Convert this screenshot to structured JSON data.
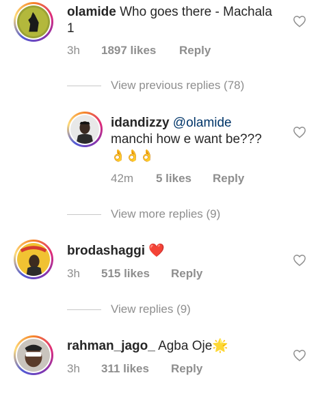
{
  "comments": [
    {
      "username": "olamide",
      "text": "Who goes there - Machala 1",
      "time": "3h",
      "likes": "1897 likes",
      "reply": "Reply",
      "thread_link": "View previous replies (78)"
    },
    {
      "username": "idandizzy",
      "mention": "@olamide",
      "text": "manchi how e want be???",
      "emoji": "👌👌👌",
      "time": "42m",
      "likes": "5 likes",
      "reply": "Reply",
      "thread_link": "View more replies (9)"
    },
    {
      "username": "brodashaggi",
      "emoji": "❤️",
      "time": "3h",
      "likes": "515 likes",
      "reply": "Reply",
      "thread_link": "View replies (9)"
    },
    {
      "username": "rahman_jago_",
      "text": "Agba Oje",
      "emoji": "🌟",
      "time": "3h",
      "likes": "311 likes",
      "reply": "Reply"
    }
  ],
  "icons": {
    "like": "heart-outline-icon"
  },
  "colors": {
    "text": "#262626",
    "muted": "#8e8e8e",
    "mention": "#003569",
    "heart": "#ed4956"
  }
}
